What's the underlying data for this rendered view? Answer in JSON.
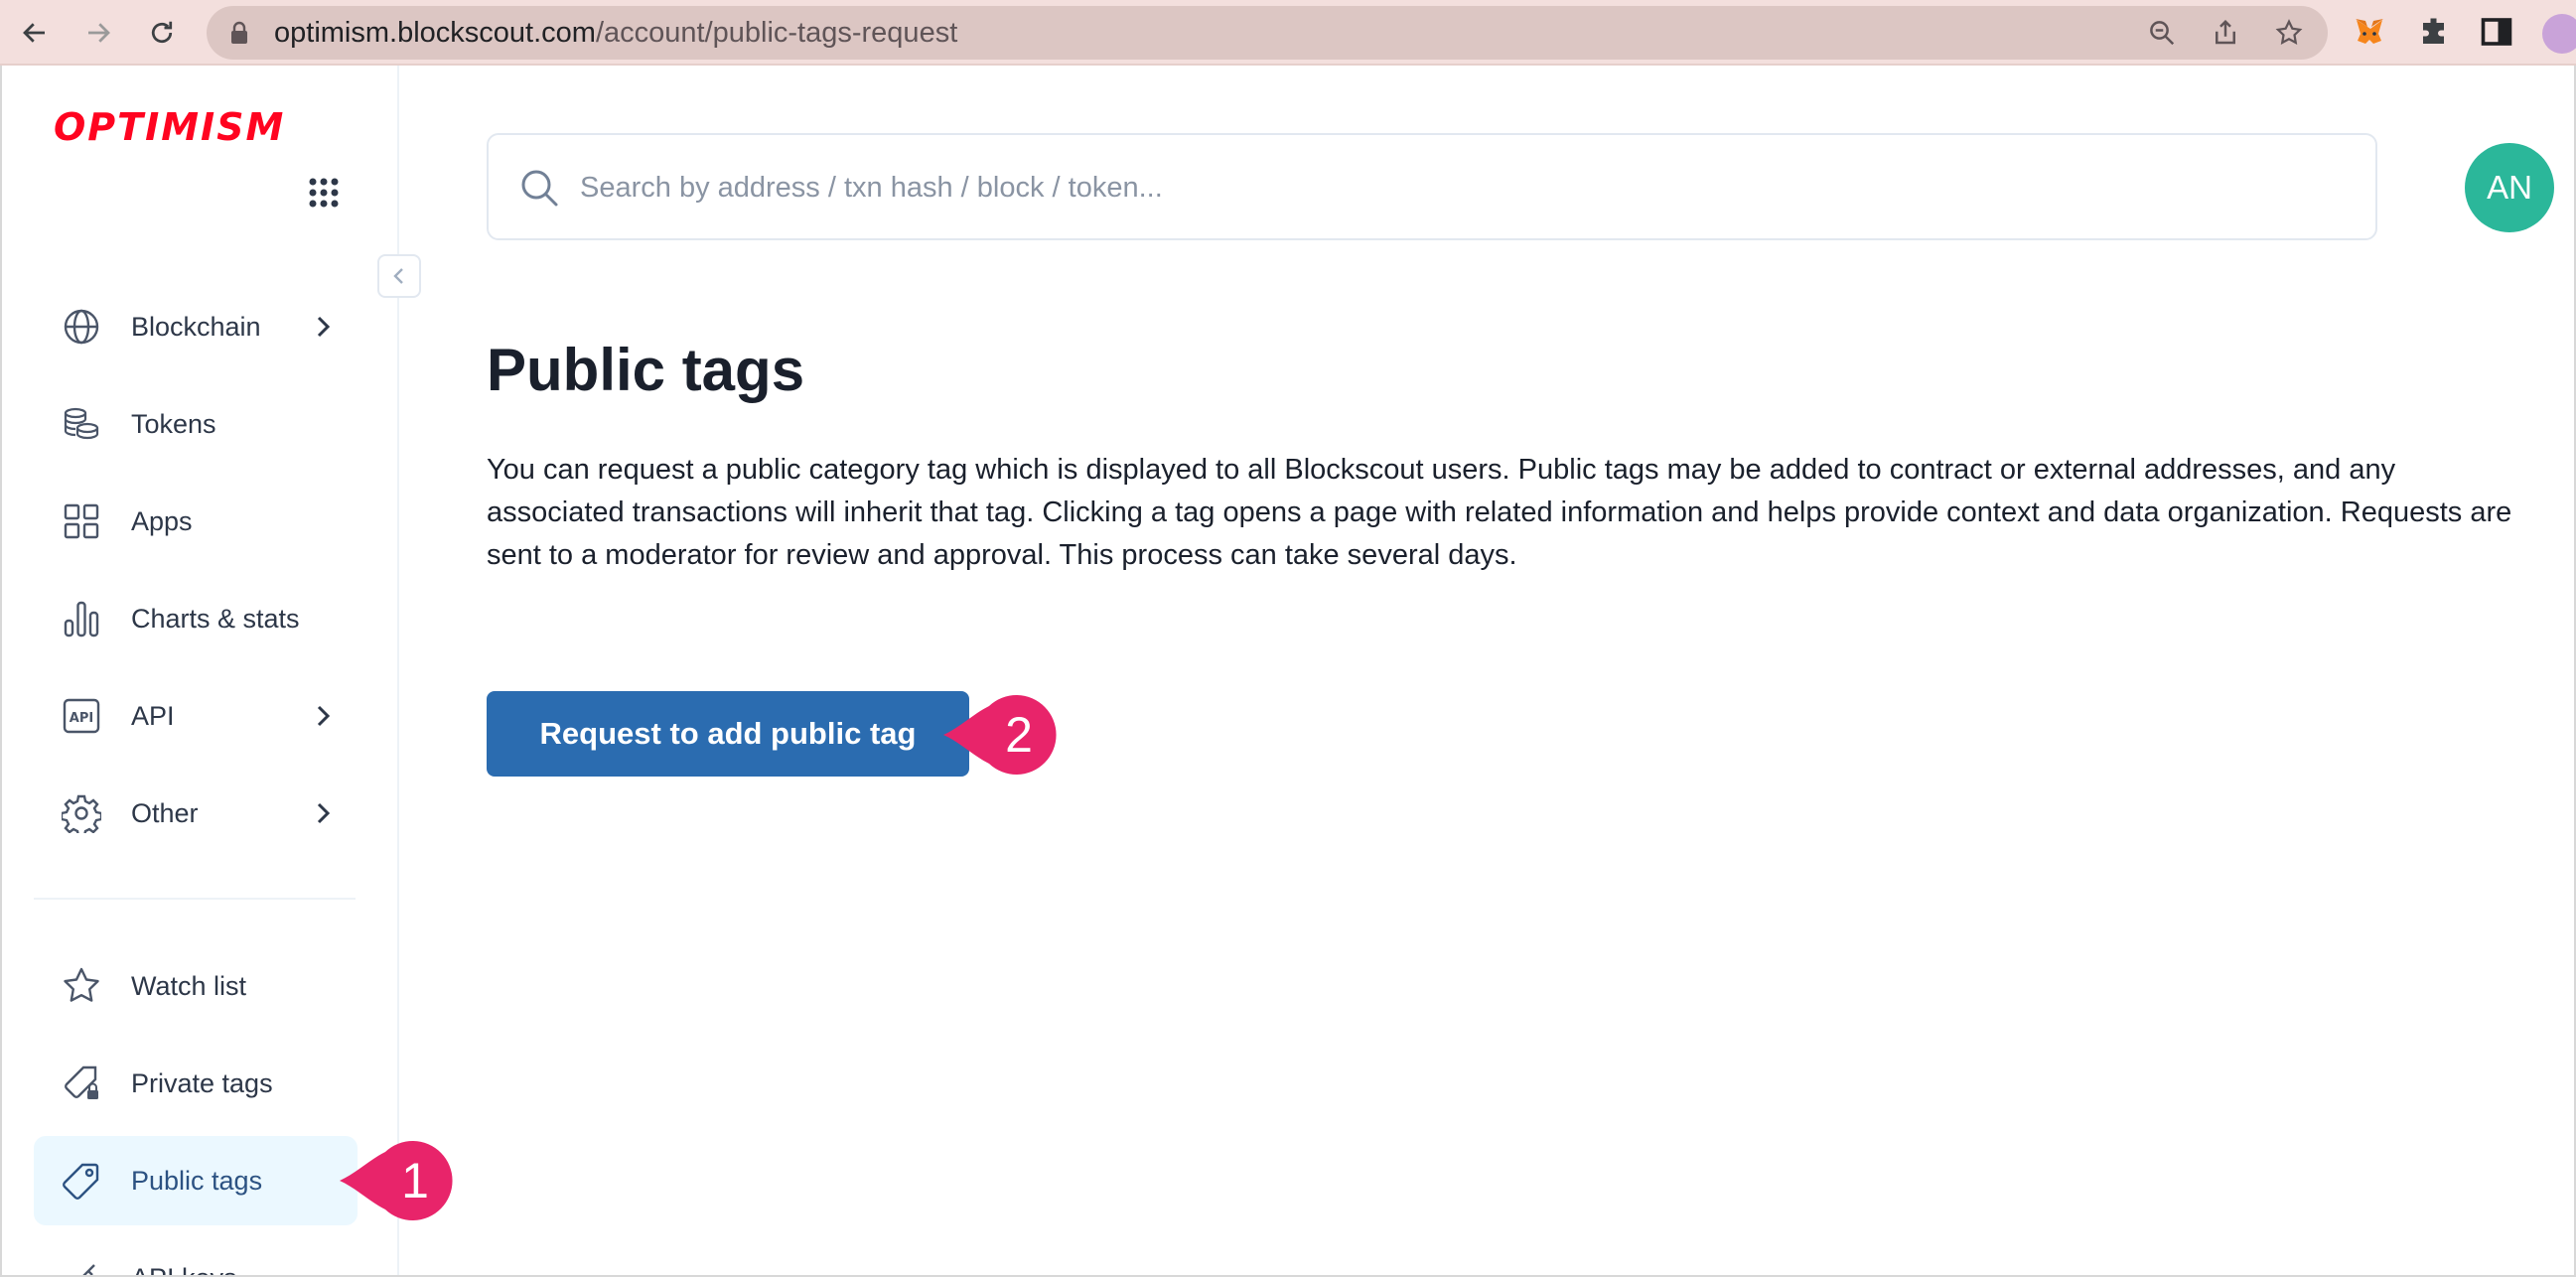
{
  "browser": {
    "url_host": "optimism.blockscout.com",
    "url_path": "/account/public-tags-request"
  },
  "sidebar": {
    "logo": "OPTIMISM",
    "nav": [
      {
        "label": "Blockchain",
        "icon": "globe-icon"
      },
      {
        "label": "Tokens",
        "icon": "coins-icon"
      },
      {
        "label": "Apps",
        "icon": "apps-icon"
      },
      {
        "label": "Charts & stats",
        "icon": "bar-chart-icon"
      },
      {
        "label": "API",
        "icon": "api-icon"
      },
      {
        "label": "Other",
        "icon": "gear-icon"
      }
    ],
    "account": [
      {
        "label": "Watch list",
        "icon": "star-icon"
      },
      {
        "label": "Private tags",
        "icon": "private-tag-icon"
      },
      {
        "label": "Public tags",
        "icon": "tag-icon"
      },
      {
        "label": "API keys",
        "icon": "key-icon"
      }
    ]
  },
  "search": {
    "placeholder": "Search by address / txn hash / block / token..."
  },
  "user": {
    "initials": "AN"
  },
  "main": {
    "title": "Public tags",
    "description": "You can request a public category tag which is displayed to all Blockscout users. Public tags may be added to contract or external addresses, and any associated transactions will inherit that tag. Clicking a tag opens a page with related information and helps provide context and data organization. Requests are sent to a moderator for review and approval. This process can take several days.",
    "request_button": "Request to add public tag"
  },
  "callouts": [
    {
      "number": "1"
    },
    {
      "number": "2"
    }
  ],
  "colors": {
    "accent": "#2b6cb0",
    "brand": "#ff0420",
    "avatar": "#2bb79a",
    "callout": "#e8246a",
    "active_bg": "#ebf8ff"
  }
}
